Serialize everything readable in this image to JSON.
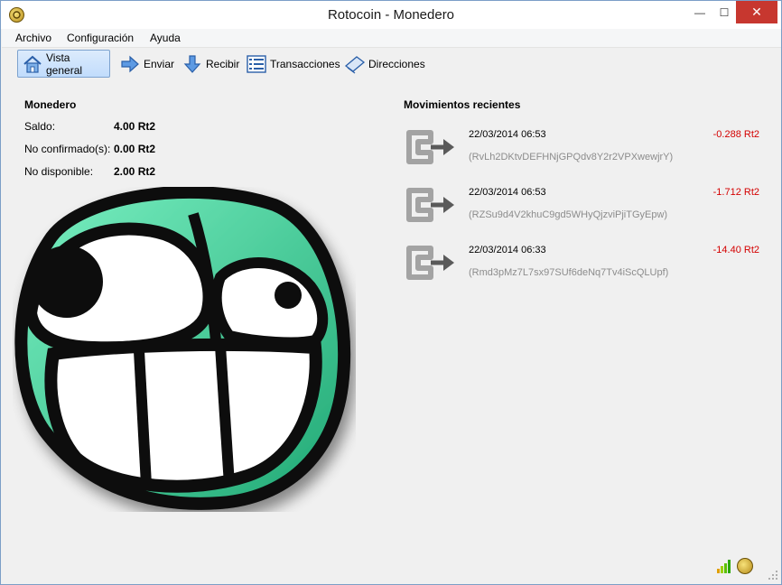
{
  "window": {
    "title": "Rotocoin - Monedero",
    "minimize_glyph": "—",
    "maximize_glyph": "☐",
    "close_glyph": "✕"
  },
  "menu": {
    "items": [
      "Archivo",
      "Configuración",
      "Ayuda"
    ]
  },
  "toolbar": {
    "items": [
      {
        "label": "Vista general",
        "icon": "home-icon",
        "active": true
      },
      {
        "label": "Enviar",
        "icon": "send-arrow-icon",
        "active": false
      },
      {
        "label": "Recibir",
        "icon": "receive-arrow-icon",
        "active": false
      },
      {
        "label": "Transacciones",
        "icon": "transactions-list-icon",
        "active": false
      },
      {
        "label": "Direcciones",
        "icon": "address-book-icon",
        "active": false
      }
    ]
  },
  "wallet": {
    "title": "Monedero",
    "balances": [
      {
        "label": "Saldo:",
        "value": "4.00 Rt2"
      },
      {
        "label": "No confirmado(s):",
        "value": "0.00 Rt2"
      },
      {
        "label": "No disponible:",
        "value": "2.00 Rt2"
      }
    ]
  },
  "recent": {
    "title": "Movimientos recientes",
    "transactions": [
      {
        "date": "22/03/2014 06:53",
        "amount": "-0.288 Rt2",
        "address": "(RvLh2DKtvDEFHNjGPQdv8Y2r2VPXwewjrY)",
        "icon": "sent-transaction-icon"
      },
      {
        "date": "22/03/2014 06:53",
        "amount": "-1.712 Rt2",
        "address": "(RZSu9d4V2khuC9gd5WHyQjzviPjiTGyEpw)",
        "icon": "sent-transaction-icon"
      },
      {
        "date": "22/03/2014 06:33",
        "amount": "-14.40 Rt2",
        "address": "(Rmd3pMz7L7sx97SUf6deNq7Tv4iScQLUpf)",
        "icon": "sent-transaction-icon"
      }
    ]
  },
  "colors": {
    "amount_negative": "#d40000",
    "address_gray": "#8c8c8c",
    "logo_green": "#3ecf95",
    "active_tab_border": "#7da2ce",
    "close_button": "#c7372f"
  },
  "status": {
    "icons": [
      "connection-signal-icon",
      "rotocoin-sync-icon"
    ]
  }
}
